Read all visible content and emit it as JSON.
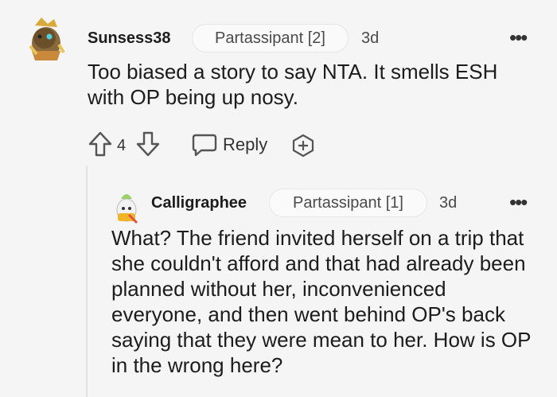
{
  "comments": [
    {
      "username": "Sunsess38",
      "flair": "Partassipant [2]",
      "time": "3d",
      "body": "Too biased a story to say NTA. It smells ESH with OP being up nosy.",
      "score": "4",
      "reply_label": "Reply",
      "more_label": "•••"
    },
    {
      "username": "Calligraphee",
      "flair": "Partassipant [1]",
      "time": "3d",
      "body": "What? The friend invited herself on a trip that she couldn't afford and that had already been planned without her, inconvenienced everyone, and then went behind OP's back saying that they were mean to her. How is OP in the wrong here?",
      "more_label": "•••"
    }
  ],
  "icons": {
    "upvote": "upvote-arrow-icon",
    "downvote": "downvote-arrow-icon",
    "reply": "speech-bubble-icon",
    "award": "plus-award-icon",
    "more": "more-dots-icon"
  }
}
